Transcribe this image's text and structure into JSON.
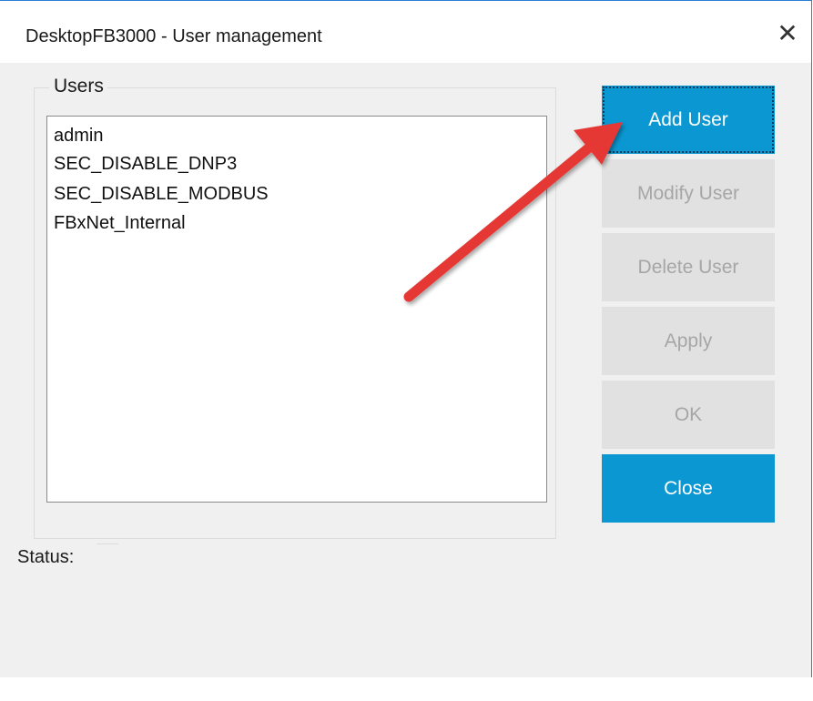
{
  "window": {
    "title": "DesktopFB3000 - User management",
    "close_glyph": "✕"
  },
  "users_group": {
    "label": "Users",
    "items": [
      "admin",
      "SEC_DISABLE_DNP3",
      "SEC_DISABLE_MODBUS",
      "FBxNet_Internal"
    ]
  },
  "buttons": {
    "add": "Add User",
    "modify": "Modify User",
    "delete": "Delete User",
    "apply": "Apply",
    "ok": "OK",
    "close": "Close"
  },
  "status": {
    "label": "Status:",
    "value": ""
  },
  "colors": {
    "accent": "#0b97d1",
    "disabled_bg": "#e1e1e1",
    "disabled_text": "#a6a6a6",
    "annotation_arrow": "#e53935"
  },
  "icons": {
    "annotation": "red-arrow-icon",
    "close": "close-icon"
  }
}
